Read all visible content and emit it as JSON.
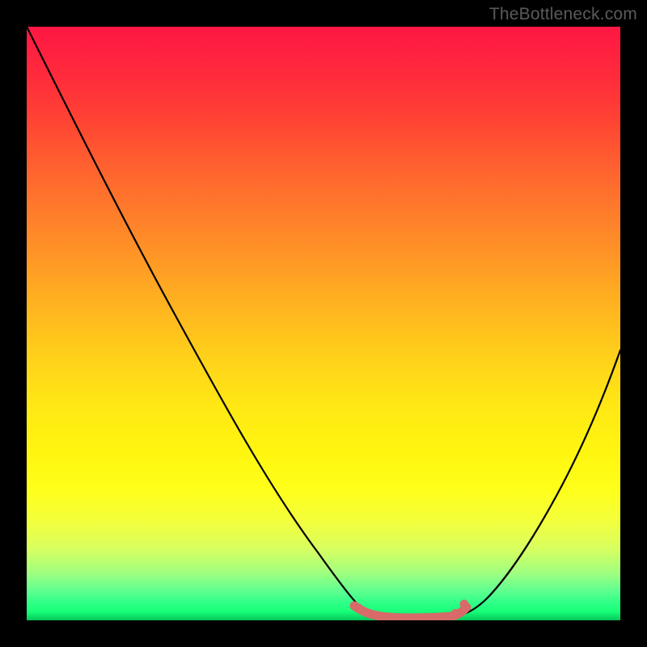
{
  "watermark": "TheBottleneck.com",
  "chart_data": {
    "type": "line",
    "title": "",
    "xlabel": "",
    "ylabel": "",
    "xlim": [
      0,
      100
    ],
    "ylim": [
      0,
      100
    ],
    "grid": false,
    "legend": false,
    "series": [
      {
        "name": "left-curve",
        "x": [
          0,
          6,
          12,
          18,
          24,
          30,
          36,
          42,
          48,
          52,
          55,
          57,
          59
        ],
        "values": [
          100,
          88,
          76,
          64,
          52,
          41,
          30,
          20,
          11,
          6,
          3,
          2,
          2
        ]
      },
      {
        "name": "right-curve",
        "x": [
          73,
          75,
          77,
          80,
          84,
          88,
          92,
          96,
          100
        ],
        "values": [
          2,
          3,
          4,
          7,
          13,
          21,
          31,
          43,
          56
        ]
      },
      {
        "name": "highlight-band",
        "x": [
          55,
          57,
          59,
          62,
          65,
          68,
          71,
          73,
          75
        ],
        "values": [
          3,
          2,
          2,
          1,
          1,
          1,
          1,
          2,
          3
        ]
      }
    ],
    "annotations": []
  }
}
